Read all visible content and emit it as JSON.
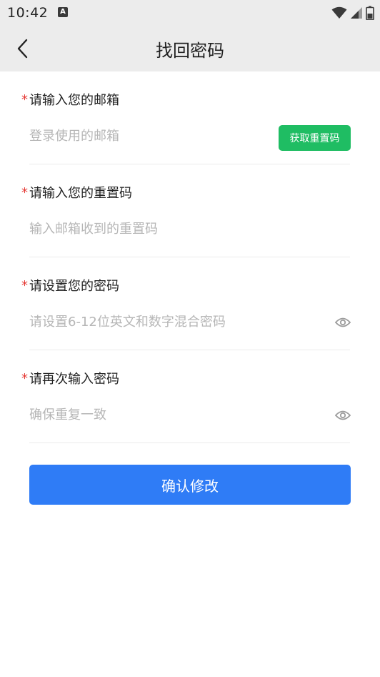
{
  "status_bar": {
    "time": "10:42",
    "notification_icon": "a-icon",
    "icons": [
      "wifi-icon",
      "signal-icon",
      "battery-icon"
    ]
  },
  "header": {
    "back_icon": "chevron-left-icon",
    "title": "找回密码"
  },
  "form": {
    "required_mark": "*",
    "email": {
      "label": "请输入您的邮箱",
      "placeholder": "登录使用的邮箱",
      "value": "",
      "button_label": "获取重置码"
    },
    "reset_code": {
      "label": "请输入您的重置码",
      "placeholder": "输入邮箱收到的重置码",
      "value": ""
    },
    "password": {
      "label": "请设置您的密码",
      "placeholder": "请设置6-12位英文和数字混合密码",
      "value": "",
      "toggle_icon": "eye-icon"
    },
    "confirm_password": {
      "label": "请再次输入密码",
      "placeholder": "确保重复一致",
      "value": "",
      "toggle_icon": "eye-icon"
    },
    "submit_label": "确认修改"
  },
  "colors": {
    "header_bg": "#ececec",
    "required": "#e53935",
    "code_button": "#1fbd63",
    "primary": "#2f7cf6",
    "placeholder": "#b6b6b6"
  }
}
